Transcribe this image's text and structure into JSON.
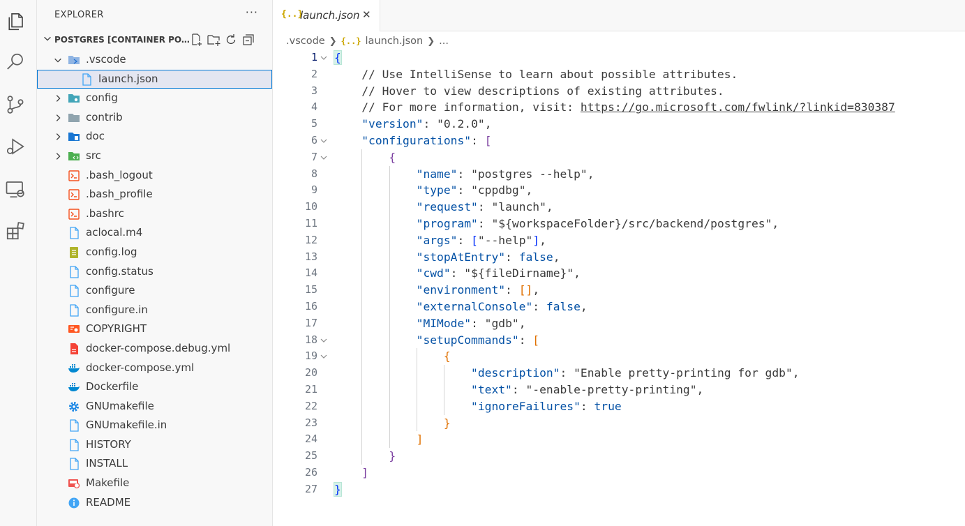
{
  "sidebar": {
    "header": "EXPLORER",
    "more": "···",
    "section_title": "POSTGRES [CONTAINER PO...",
    "items": [
      {
        "label": ".vscode",
        "kind": "folder-open",
        "icon": "vscode-folder-icon",
        "depth": 0
      },
      {
        "label": "launch.json",
        "kind": "file",
        "icon": "json-file-icon",
        "depth": 1,
        "selected": true
      },
      {
        "label": "config",
        "kind": "folder",
        "icon": "config-folder-icon",
        "depth": 0
      },
      {
        "label": "contrib",
        "kind": "folder",
        "icon": "folder-icon",
        "depth": 0
      },
      {
        "label": "doc",
        "kind": "folder",
        "icon": "doc-folder-icon",
        "depth": 0
      },
      {
        "label": "src",
        "kind": "folder",
        "icon": "src-folder-icon",
        "depth": 0
      },
      {
        "label": ".bash_logout",
        "kind": "file",
        "icon": "terminal-file-icon",
        "depth": 0
      },
      {
        "label": ".bash_profile",
        "kind": "file",
        "icon": "terminal-file-icon",
        "depth": 0
      },
      {
        "label": ".bashrc",
        "kind": "file",
        "icon": "terminal-file-icon",
        "depth": 0
      },
      {
        "label": "aclocal.m4",
        "kind": "file",
        "icon": "generic-file-icon",
        "depth": 0
      },
      {
        "label": "config.log",
        "kind": "file",
        "icon": "log-file-icon",
        "depth": 0
      },
      {
        "label": "config.status",
        "kind": "file",
        "icon": "generic-file-icon",
        "depth": 0
      },
      {
        "label": "configure",
        "kind": "file",
        "icon": "generic-file-icon",
        "depth": 0
      },
      {
        "label": "configure.in",
        "kind": "file",
        "icon": "generic-file-icon",
        "depth": 0
      },
      {
        "label": "COPYRIGHT",
        "kind": "file",
        "icon": "license-file-icon",
        "depth": 0
      },
      {
        "label": "docker-compose.debug.yml",
        "kind": "file",
        "icon": "yaml-file-icon",
        "depth": 0
      },
      {
        "label": "docker-compose.yml",
        "kind": "file",
        "icon": "docker-file-icon",
        "depth": 0
      },
      {
        "label": "Dockerfile",
        "kind": "file",
        "icon": "docker-file-icon",
        "depth": 0
      },
      {
        "label": "GNUmakefile",
        "kind": "file",
        "icon": "gear-file-icon",
        "depth": 0
      },
      {
        "label": "GNUmakefile.in",
        "kind": "file",
        "icon": "generic-file-icon",
        "depth": 0
      },
      {
        "label": "HISTORY",
        "kind": "file",
        "icon": "generic-file-icon",
        "depth": 0
      },
      {
        "label": "INSTALL",
        "kind": "file",
        "icon": "generic-file-icon",
        "depth": 0
      },
      {
        "label": "Makefile",
        "kind": "file",
        "icon": "makefile-icon",
        "depth": 0
      },
      {
        "label": "README",
        "kind": "file",
        "icon": "info-file-icon",
        "depth": 0
      }
    ]
  },
  "tab": {
    "icon": "{..}",
    "label": "launch.json",
    "close": "✕"
  },
  "breadcrumb": {
    "folder": ".vscode",
    "icon": "{..}",
    "file": "launch.json",
    "rest": "..."
  },
  "code": {
    "line_numbers": [
      "1",
      "2",
      "3",
      "4",
      "5",
      "6",
      "7",
      "8",
      "9",
      "10",
      "11",
      "12",
      "13",
      "14",
      "15",
      "16",
      "17",
      "18",
      "19",
      "20",
      "21",
      "22",
      "23",
      "24",
      "25",
      "26",
      "27"
    ],
    "fold_lines": [
      1,
      6,
      7,
      18,
      19
    ],
    "lines": [
      "{",
      "    // Use IntelliSense to learn about possible attributes.",
      "    // Hover to view descriptions of existing attributes.",
      "    // For more information, visit: https://go.microsoft.com/fwlink/?linkid=830387",
      "    \"version\": \"0.2.0\",",
      "    \"configurations\": [",
      "        {",
      "            \"name\": \"postgres --help\",",
      "            \"type\": \"cppdbg\",",
      "            \"request\": \"launch\",",
      "            \"program\": \"${workspaceFolder}/src/backend/postgres\",",
      "            \"args\": [\"--help\"],",
      "            \"stopAtEntry\": false,",
      "            \"cwd\": \"${fileDirname}\",",
      "            \"environment\": [],",
      "            \"externalConsole\": false,",
      "            \"MIMode\": \"gdb\",",
      "            \"setupCommands\": [",
      "                {",
      "                    \"description\": \"Enable pretty-printing for gdb\",",
      "                    \"text\": \"-enable-pretty-printing\",",
      "                    \"ignoreFailures\": true",
      "                }",
      "            ]",
      "        }",
      "    ]",
      "}"
    ]
  }
}
